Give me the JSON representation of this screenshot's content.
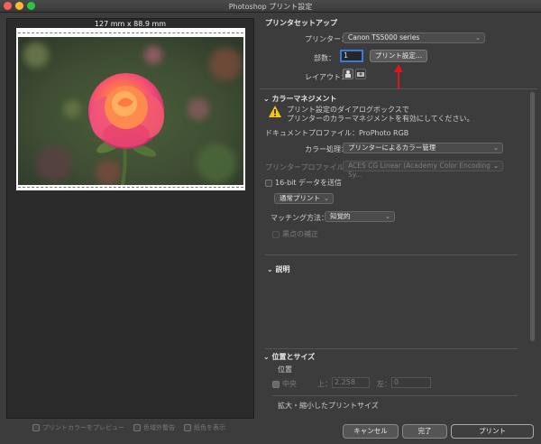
{
  "window": {
    "title": "Photoshop プリント設定"
  },
  "preview": {
    "dimensions": "127 mm x 88.9 mm"
  },
  "preview_options": [
    {
      "label": "プリントカラーをプレビュー"
    },
    {
      "label": "色域外警告"
    },
    {
      "label": "紙色を表示"
    }
  ],
  "printer_setup": {
    "heading": "プリンタセットアップ",
    "printer_label": "プリンター：",
    "printer_value": "Canon TS5000 series",
    "copies_label": "部数：",
    "copies_value": "1",
    "print_settings_button": "プリント設定...",
    "layout_label": "レイアウト："
  },
  "color_management": {
    "heading": "カラーマネジメント",
    "warning_line1": "プリント設定のダイアログボックスで",
    "warning_line2": "プリンターのカラーマネジメントを有効にしてください。",
    "document_profile": "ドキュメントプロファイル：ProPhoto RGB",
    "color_handling_label": "カラー処理：",
    "color_handling_value": "プリンターによるカラー管理",
    "printer_profile_label": "プリンタープロファイル：",
    "printer_profile_value": "ACES CG Linear (Academy Color Encoding Sy...",
    "send_16bit": "16-bit データを送信",
    "print_mode": "通常プリント",
    "rendering_intent_label": "マッチング方法：",
    "rendering_intent_value": "知覚的",
    "black_point": "黒点の補正"
  },
  "description": {
    "heading": "説明"
  },
  "position_size": {
    "heading": "位置とサイズ",
    "position_label": "位置",
    "center_label": "中央",
    "top_label": "上：",
    "top_value": "2.258",
    "left_label": "左：",
    "left_value": "0",
    "scaled_label": "拡大・縮小したプリントサイズ"
  },
  "footer": {
    "cancel": "キャンセル",
    "done": "完了",
    "print": "プリント"
  },
  "colors": {
    "accent": "#3a7bd5",
    "annotation_arrow": "#e0141e",
    "warning": "#f5c518"
  }
}
